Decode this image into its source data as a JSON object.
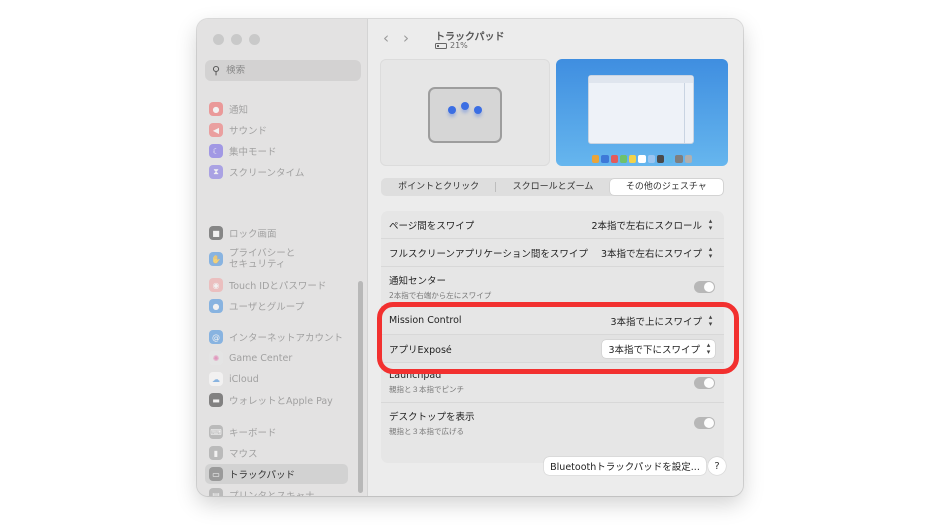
{
  "sidebar": {
    "search_placeholder": "検索",
    "items": [
      {
        "label": "通知",
        "icon": "bell-icon",
        "color": "#f05f5f"
      },
      {
        "label": "サウンド",
        "icon": "speaker-icon",
        "color": "#f06a6a"
      },
      {
        "label": "集中モード",
        "icon": "moon-icon",
        "color": "#6c5ce7"
      },
      {
        "label": "スクリーンタイム",
        "icon": "hourglass-icon",
        "color": "#7c6ee4"
      },
      {
        "label": "ロック画面",
        "icon": "lock-icon",
        "color": "#3b3b3b"
      },
      {
        "label": "プライバシーと\nセキュリティ",
        "icon": "hand-icon",
        "color": "#3f8ee0"
      },
      {
        "label": "Touch IDとパスワード",
        "icon": "fingerprint-icon",
        "color": "#f2a3a3"
      },
      {
        "label": "ユーザとグループ",
        "icon": "users-icon",
        "color": "#3f8ee0"
      },
      {
        "label": "インターネットアカウント",
        "icon": "at-icon",
        "color": "#3f8ee0"
      },
      {
        "label": "Game Center",
        "icon": "game-center-icon",
        "color": "#e0e0e0"
      },
      {
        "label": "iCloud",
        "icon": "cloud-icon",
        "color": "#ffffff"
      },
      {
        "label": "ウォレットとApple Pay",
        "icon": "wallet-icon",
        "color": "#333333"
      },
      {
        "label": "キーボード",
        "icon": "keyboard-icon",
        "color": "#9a9a9a"
      },
      {
        "label": "マウス",
        "icon": "mouse-icon",
        "color": "#9a9a9a"
      },
      {
        "label": "トラックパッド",
        "icon": "trackpad-icon",
        "color": "#9a9a9a"
      },
      {
        "label": "プリンタとスキャナ",
        "icon": "printer-icon",
        "color": "#9a9a9a"
      }
    ]
  },
  "header": {
    "back_icon": "chevron-left-icon",
    "forward_icon": "chevron-right-icon",
    "title": "トラックパッド",
    "battery": "21%"
  },
  "tabs": [
    {
      "label": "ポイントとクリック",
      "active": false
    },
    {
      "label": "スクロールとズーム",
      "active": false
    },
    {
      "label": "その他のジェスチャ",
      "active": true
    }
  ],
  "settings": [
    {
      "label": "ページ間をスワイプ",
      "value": "2本指で左右にスクロール",
      "type": "popup"
    },
    {
      "label": "フルスクリーンアプリケーション間をスワイプ",
      "value": "3本指で左右にスワイプ",
      "type": "popup"
    },
    {
      "label": "通知センター",
      "sub": "2本指で右端から左にスワイプ",
      "type": "toggle"
    },
    {
      "label": "Mission Control",
      "value": "3本指で上にスワイプ",
      "type": "popup"
    },
    {
      "label": "アプリExposé",
      "value": "3本指で下にスワイプ",
      "type": "popup"
    },
    {
      "label": "Launchpad",
      "sub": "親指と３本指でピンチ",
      "type": "toggle"
    },
    {
      "label": "デスクトップを表示",
      "sub": "親指と３本指で広げる",
      "type": "toggle"
    }
  ],
  "footer": {
    "bluetooth_button": "Bluetoothトラックパッドを設定...",
    "help": "?"
  },
  "accent": "#f2302f"
}
